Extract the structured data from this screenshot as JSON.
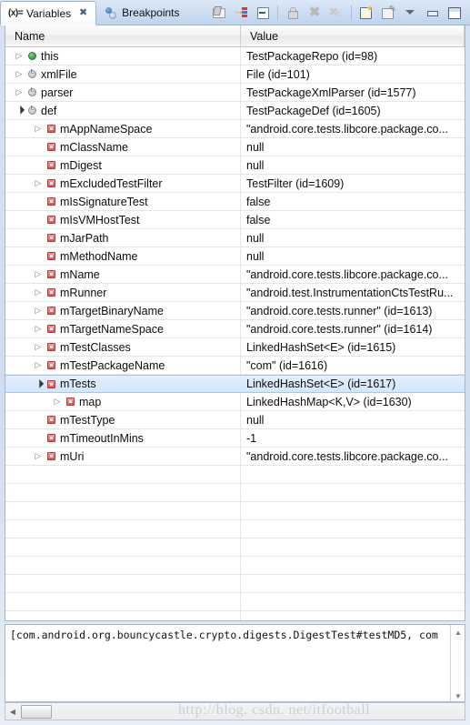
{
  "window": {
    "tabs": [
      {
        "label": "Variables",
        "icon": "variables-icon",
        "active": true,
        "closable": true
      },
      {
        "label": "Breakpoints",
        "icon": "breakpoints-icon",
        "active": false,
        "closable": false
      }
    ],
    "toolbar": [
      {
        "name": "show-logical-structure-icon",
        "enabled": true
      },
      {
        "name": "show-type-names-icon",
        "enabled": true
      },
      {
        "name": "collapse-all-icon",
        "enabled": true
      },
      {
        "name": "lock-icon",
        "enabled": false
      },
      {
        "name": "remove-icon",
        "enabled": false
      },
      {
        "name": "remove-all-icon",
        "enabled": false
      },
      {
        "name": "new-watch-expression-icon",
        "enabled": true
      },
      {
        "name": "edit-watch-expression-icon",
        "enabled": true
      },
      {
        "name": "view-menu-icon",
        "enabled": true
      },
      {
        "name": "minimize-icon",
        "enabled": true
      },
      {
        "name": "maximize-icon",
        "enabled": true
      }
    ]
  },
  "table": {
    "columns": {
      "name": "Name",
      "value": "Value"
    },
    "rows": [
      {
        "indent": 0,
        "twisty": "closed",
        "icon": "this",
        "name": "this",
        "value": "TestPackageRepo  (id=98)"
      },
      {
        "indent": 0,
        "twisty": "closed",
        "icon": "local",
        "name": "xmlFile",
        "value": "File  (id=101)"
      },
      {
        "indent": 0,
        "twisty": "closed",
        "icon": "local",
        "name": "parser",
        "value": "TestPackageXmlParser  (id=1577)"
      },
      {
        "indent": 0,
        "twisty": "open",
        "icon": "local",
        "name": "def",
        "value": "TestPackageDef  (id=1605)"
      },
      {
        "indent": 1,
        "twisty": "closed",
        "icon": "field",
        "name": "mAppNameSpace",
        "value": "\"android.core.tests.libcore.package.co..."
      },
      {
        "indent": 1,
        "twisty": "none",
        "icon": "field",
        "name": "mClassName",
        "value": "null"
      },
      {
        "indent": 1,
        "twisty": "none",
        "icon": "field",
        "name": "mDigest",
        "value": "null"
      },
      {
        "indent": 1,
        "twisty": "closed",
        "icon": "field",
        "name": "mExcludedTestFilter",
        "value": "TestFilter  (id=1609)"
      },
      {
        "indent": 1,
        "twisty": "none",
        "icon": "field",
        "name": "mIsSignatureTest",
        "value": "false"
      },
      {
        "indent": 1,
        "twisty": "none",
        "icon": "field",
        "name": "mIsVMHostTest",
        "value": "false"
      },
      {
        "indent": 1,
        "twisty": "none",
        "icon": "field",
        "name": "mJarPath",
        "value": "null"
      },
      {
        "indent": 1,
        "twisty": "none",
        "icon": "field",
        "name": "mMethodName",
        "value": "null"
      },
      {
        "indent": 1,
        "twisty": "closed",
        "icon": "field",
        "name": "mName",
        "value": "\"android.core.tests.libcore.package.co..."
      },
      {
        "indent": 1,
        "twisty": "closed",
        "icon": "field",
        "name": "mRunner",
        "value": "\"android.test.InstrumentationCtsTestRu..."
      },
      {
        "indent": 1,
        "twisty": "closed",
        "icon": "field",
        "name": "mTargetBinaryName",
        "value": "\"android.core.tests.runner\" (id=1613)"
      },
      {
        "indent": 1,
        "twisty": "closed",
        "icon": "field",
        "name": "mTargetNameSpace",
        "value": "\"android.core.tests.runner\" (id=1614)"
      },
      {
        "indent": 1,
        "twisty": "closed",
        "icon": "field",
        "name": "mTestClasses",
        "value": "LinkedHashSet<E>  (id=1615)"
      },
      {
        "indent": 1,
        "twisty": "closed",
        "icon": "field",
        "name": "mTestPackageName",
        "value": "\"com\" (id=1616)"
      },
      {
        "indent": 1,
        "twisty": "open",
        "icon": "field",
        "name": "mTests",
        "value": "LinkedHashSet<E>  (id=1617)",
        "selected": true
      },
      {
        "indent": 2,
        "twisty": "closed",
        "icon": "field",
        "name": "map",
        "value": "LinkedHashMap<K,V>  (id=1630)"
      },
      {
        "indent": 1,
        "twisty": "none",
        "icon": "field",
        "name": "mTestType",
        "value": "null"
      },
      {
        "indent": 1,
        "twisty": "none",
        "icon": "field",
        "name": "mTimeoutInMins",
        "value": "-1"
      },
      {
        "indent": 1,
        "twisty": "closed",
        "icon": "field",
        "name": "mUri",
        "value": "\"android.core.tests.libcore.package.co..."
      }
    ],
    "empty_row_count": 9
  },
  "detail_pane": {
    "text": "[com.android.org.bouncycastle.crypto.digests.DigestTest#testMD5, com",
    "scroll_up_icon": "scroll-up-icon",
    "scroll_down_icon": "scroll-down-icon"
  },
  "watermark": {
    "text": "http://blog. csdn. net/itfootball"
  },
  "colors": {
    "selection_bg": "#d3e6fb",
    "selection_border": "#a6c8ea",
    "this_icon": "#2f9c3f",
    "field_icon": "#e05555",
    "panel_bg": "#cfddef"
  }
}
